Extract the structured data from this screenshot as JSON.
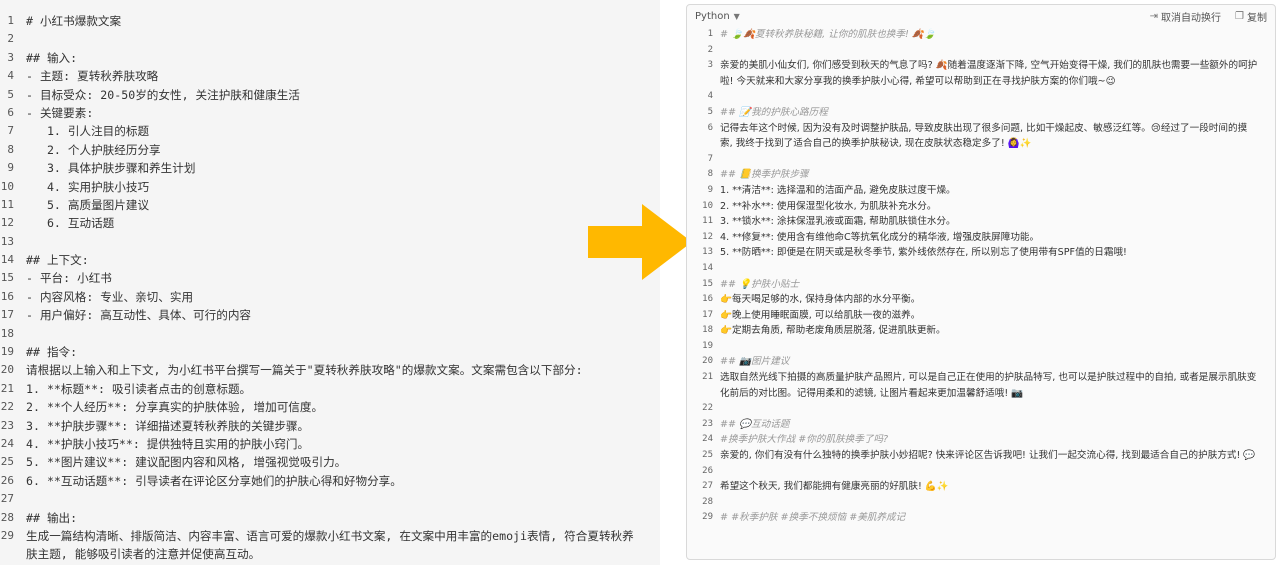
{
  "left": {
    "lines": [
      {
        "n": "1",
        "t": "# 小红书爆款文案"
      },
      {
        "n": "2",
        "t": ""
      },
      {
        "n": "3",
        "t": "## 输入:"
      },
      {
        "n": "4",
        "t": "- 主题: 夏转秋养肤攻略"
      },
      {
        "n": "5",
        "t": "- 目标受众: 20-50岁的女性, 关注护肤和健康生活"
      },
      {
        "n": "6",
        "t": "- 关键要素:"
      },
      {
        "n": "7",
        "t": "   1. 引人注目的标题"
      },
      {
        "n": "8",
        "t": "   2. 个人护肤经历分享"
      },
      {
        "n": "9",
        "t": "   3. 具体护肤步骤和养生计划"
      },
      {
        "n": "10",
        "t": "   4. 实用护肤小技巧"
      },
      {
        "n": "11",
        "t": "   5. 高质量图片建议"
      },
      {
        "n": "12",
        "t": "   6. 互动话题"
      },
      {
        "n": "13",
        "t": ""
      },
      {
        "n": "14",
        "t": "## 上下文:"
      },
      {
        "n": "15",
        "t": "- 平台: 小红书"
      },
      {
        "n": "16",
        "t": "- 内容风格: 专业、亲切、实用"
      },
      {
        "n": "17",
        "t": "- 用户偏好: 高互动性、具体、可行的内容"
      },
      {
        "n": "18",
        "t": ""
      },
      {
        "n": "19",
        "t": "## 指令:"
      },
      {
        "n": "20",
        "t": "请根据以上输入和上下文, 为小红书平台撰写一篇关于\"夏转秋养肤攻略\"的爆款文案。文案需包含以下部分:"
      },
      {
        "n": "21",
        "t": "1. **标题**: 吸引读者点击的创意标题。"
      },
      {
        "n": "22",
        "t": "2. **个人经历**: 分享真实的护肤体验, 增加可信度。"
      },
      {
        "n": "23",
        "t": "3. **护肤步骤**: 详细描述夏转秋养肤的关键步骤。"
      },
      {
        "n": "24",
        "t": "4. **护肤小技巧**: 提供独特且实用的护肤小窍门。"
      },
      {
        "n": "25",
        "t": "5. **图片建议**: 建议配图内容和风格, 增强视觉吸引力。"
      },
      {
        "n": "26",
        "t": "6. **互动话题**: 引导读者在评论区分享她们的护肤心得和好物分享。"
      },
      {
        "n": "27",
        "t": ""
      },
      {
        "n": "28",
        "t": "## 输出:"
      },
      {
        "n": "29",
        "t": "生成一篇结构清晰、排版简洁、内容丰富、语言可爱的爆款小红书文案, 在文案中用丰富的emoji表情, 符合夏转秋养肤主题, 能够吸引读者的注意并促使高互动。",
        "wrap": true
      }
    ]
  },
  "right": {
    "language": "Python",
    "wrap_toggle_label": "取消自动换行",
    "copy_label": "复制",
    "lines": [
      {
        "n": "1",
        "t": "# 🍃🍂夏转秋养肤秘籍, 让你的肌肤也换季! 🍂🍃",
        "kind": "heading"
      },
      {
        "n": "2",
        "t": ""
      },
      {
        "n": "3",
        "t": "亲爱的美肌小仙女们, 你们感受到秋天的气息了吗? 🍂随着温度逐渐下降, 空气开始变得干燥, 我们的肌肤也需要一些额外的呵护啦! 今天就来和大家分享我的换季护肤小心得, 希望可以帮助到正在寻找护肤方案的你们哦~😉"
      },
      {
        "n": "4",
        "t": ""
      },
      {
        "n": "5",
        "t": "## 📝我的护肤心路历程",
        "kind": "heading"
      },
      {
        "n": "6",
        "t": "记得去年这个时候, 因为没有及时调整护肤品, 导致皮肤出现了很多问题, 比如干燥起皮、敏感泛红等。😢经过了一段时间的摸索, 我终于找到了适合自己的换季护肤秘诀, 现在皮肤状态稳定多了! 🙆‍♀️✨"
      },
      {
        "n": "7",
        "t": ""
      },
      {
        "n": "8",
        "t": "## 📒换季护肤步骤",
        "kind": "heading"
      },
      {
        "n": "9",
        "t": "1. **清洁**: 选择温和的洁面产品, 避免皮肤过度干燥。",
        "kind": "num"
      },
      {
        "n": "10",
        "t": "2. **补水**: 使用保湿型化妆水, 为肌肤补充水分。",
        "kind": "num"
      },
      {
        "n": "11",
        "t": "3. **锁水**: 涂抹保湿乳液或面霜, 帮助肌肤锁住水分。",
        "kind": "num"
      },
      {
        "n": "12",
        "t": "4. **修复**: 使用含有维他命C等抗氧化成分的精华液, 增强皮肤屏障功能。",
        "kind": "num"
      },
      {
        "n": "13",
        "t": "5. **防晒**: 即便是在阴天或是秋冬季节, 紫外线依然存在, 所以别忘了使用带有SPF值的日霜哦!",
        "kind": "num"
      },
      {
        "n": "14",
        "t": ""
      },
      {
        "n": "15",
        "t": "## 💡护肤小贴士",
        "kind": "heading"
      },
      {
        "n": "16",
        "t": "👉每天喝足够的水, 保持身体内部的水分平衡。"
      },
      {
        "n": "17",
        "t": "👉晚上使用睡眠面膜, 可以给肌肤一夜的滋养。"
      },
      {
        "n": "18",
        "t": "👉定期去角质, 帮助老废角质层脱落, 促进肌肤更新。"
      },
      {
        "n": "19",
        "t": ""
      },
      {
        "n": "20",
        "t": "## 📷图片建议",
        "kind": "heading"
      },
      {
        "n": "21",
        "t": "选取自然光线下拍摄的高质量护肤产品照片, 可以是自己正在使用的护肤品特写, 也可以是护肤过程中的自拍, 或者是展示肌肤变化前后的对比图。记得用柔和的滤镜, 让图片看起来更加温馨舒适哦! 📷"
      },
      {
        "n": "22",
        "t": ""
      },
      {
        "n": "23",
        "t": "## 💬互动话题",
        "kind": "heading"
      },
      {
        "n": "24",
        "t": "#换季护肤大作战 #你的肌肤换季了吗?",
        "kind": "heading"
      },
      {
        "n": "25",
        "t": "亲爱的, 你们有没有什么独特的换季护肤小妙招呢? 快来评论区告诉我吧! 让我们一起交流心得, 找到最适合自己的护肤方式! 💬"
      },
      {
        "n": "26",
        "t": ""
      },
      {
        "n": "27",
        "t": "希望这个秋天, 我们都能拥有健康亮丽的好肌肤! 💪✨"
      },
      {
        "n": "28",
        "t": ""
      },
      {
        "n": "29",
        "t": "# #秋季护肤 #换季不换烦恼 #美肌养成记",
        "kind": "heading"
      }
    ]
  },
  "arrow": {
    "color": "#FFB800"
  }
}
